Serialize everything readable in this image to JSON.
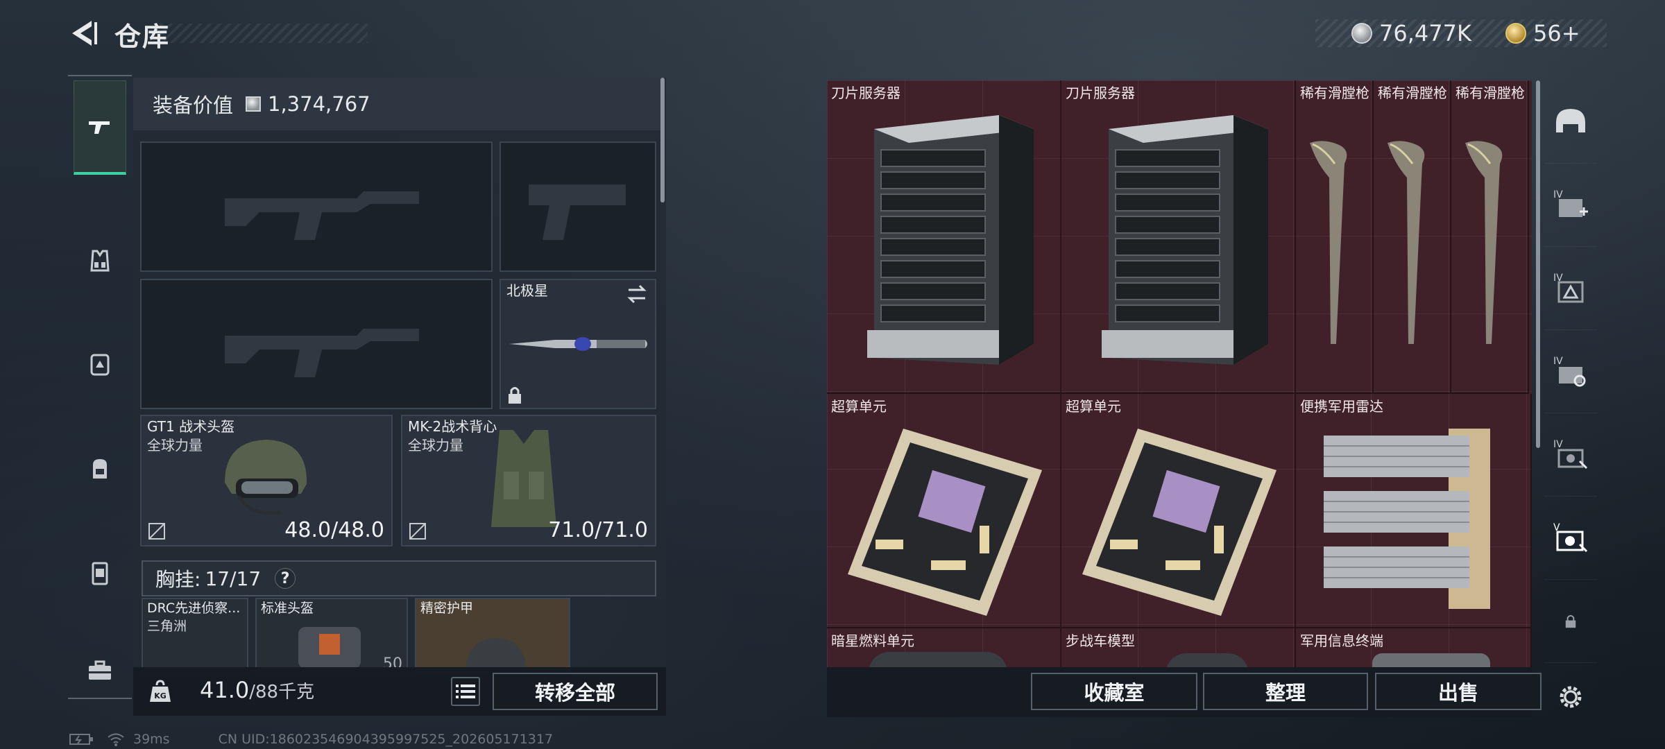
{
  "header": {
    "title": "仓库",
    "currency_silver": "76,477K",
    "currency_gold": "56+"
  },
  "loadout": {
    "value_label": "装备价值",
    "value": "1,374,767",
    "melee_name": "北极星",
    "helmet": {
      "name": "GT1 战术头盔",
      "faction": "全球力量",
      "durability": "48.0/48.0"
    },
    "armor": {
      "name": "MK-2战术背心",
      "faction": "全球力量",
      "durability": "71.0/71.0"
    },
    "chest_label": "胸挂:",
    "chest_count": "17/17",
    "help": "?",
    "mini_items": [
      {
        "name": "DRC先进侦察...",
        "sub": "三角洲"
      },
      {
        "name": "标准头盔",
        "value": "50"
      },
      {
        "name": "精密护甲"
      }
    ],
    "weight": "41.0",
    "weight_max": "/88千克",
    "transfer_all": "转移全部"
  },
  "storage": {
    "items": [
      {
        "label": "刀片服务器"
      },
      {
        "label": "刀片服务器"
      },
      {
        "label": "稀有滑膛枪"
      },
      {
        "label": "稀有滑膛枪"
      },
      {
        "label": "稀有滑膛枪"
      },
      {
        "label": "超算单元"
      },
      {
        "label": "超算单元"
      },
      {
        "label": "便携军用雷达"
      },
      {
        "label": "暗星燃料单元"
      },
      {
        "label": "步战车模型"
      },
      {
        "label": "军用信息终端"
      }
    ],
    "buttons": {
      "collection": "收藏室",
      "organize": "整理",
      "sell": "出售"
    }
  },
  "status": {
    "ping": "39ms",
    "uid": "CN UID:1860235469043959975​25_202605171317"
  },
  "colors": {
    "accent": "#3fd0a6",
    "storage_bg": "#40212a",
    "panel_bg": "#222a34"
  },
  "icons": {
    "rail": [
      "gun-icon",
      "vest-icon",
      "armor-icon",
      "backpack-icon",
      "case-icon",
      "toolbox-icon"
    ],
    "right_rail": [
      "helmet-icon",
      "tier4-add-icon",
      "tier4-warning-icon",
      "tier4-gear-icon",
      "tier4-tool-icon",
      "tier4-active-icon",
      "lock-icon",
      "settings-icon"
    ]
  }
}
